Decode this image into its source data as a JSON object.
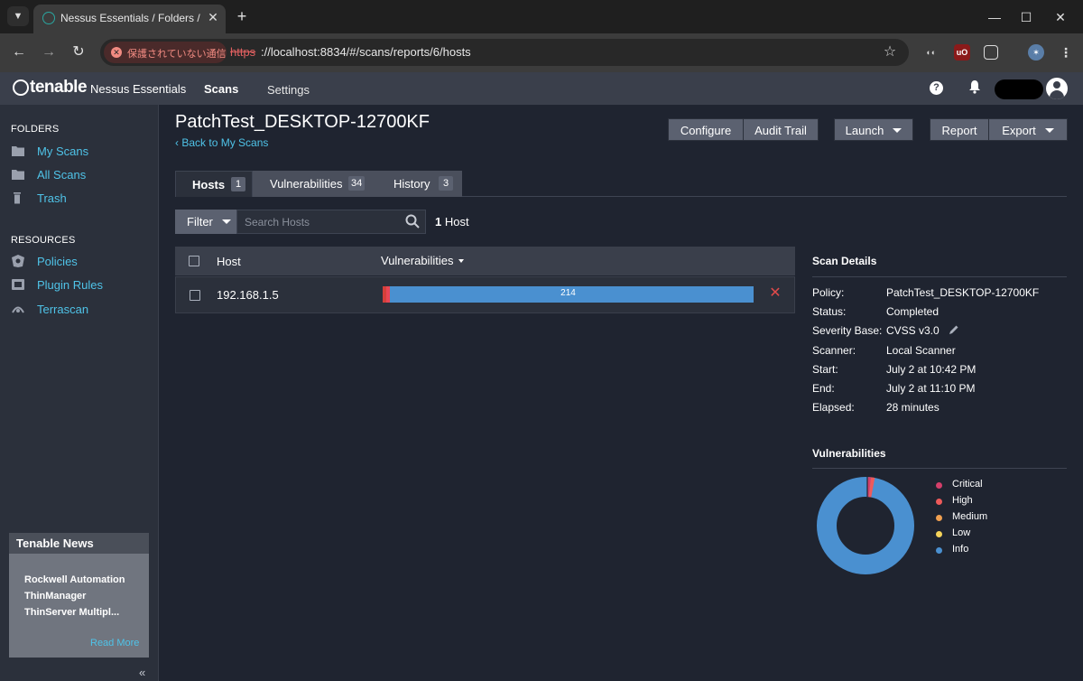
{
  "browser": {
    "tab_title": "Nessus Essentials / Folders / View Scan",
    "security_label": "保護されていない通信",
    "url_scheme": "https",
    "url_rest": "://localhost:8834/#/scans/reports/6/hosts"
  },
  "app": {
    "logo_word": "tenable",
    "logo_product": "Nessus Essentials",
    "nav_scans": "Scans",
    "nav_settings": "Settings"
  },
  "sidebar": {
    "folders_heading": "FOLDERS",
    "folders": [
      {
        "label": "My Scans",
        "icon": "folder-icon"
      },
      {
        "label": "All Scans",
        "icon": "folder-icon"
      },
      {
        "label": "Trash",
        "icon": "trash-icon"
      }
    ],
    "resources_heading": "RESOURCES",
    "resources": [
      {
        "label": "Policies",
        "icon": "policy-shield-icon"
      },
      {
        "label": "Plugin Rules",
        "icon": "plugin-rules-icon"
      },
      {
        "label": "Terrascan",
        "icon": "terrascan-icon"
      }
    ],
    "news": {
      "title": "Tenable News",
      "line1": "Rockwell Automation",
      "line2": "ThinManager",
      "line3": "ThinServer Multipl...",
      "read_more": "Read More"
    }
  },
  "main": {
    "title": "PatchTest_DESKTOP-12700KF",
    "back_link": "Back to My Scans",
    "buttons": {
      "configure": "Configure",
      "audit_trail": "Audit Trail",
      "launch": "Launch",
      "report": "Report",
      "export": "Export"
    },
    "tabs": [
      {
        "label": "Hosts",
        "count": "1"
      },
      {
        "label": "Vulnerabilities",
        "count": "34"
      },
      {
        "label": "History",
        "count": "3"
      }
    ],
    "filter_label": "Filter",
    "search_placeholder": "Search Hosts",
    "host_count_num": "1",
    "host_count_word": "Host",
    "table": {
      "col_host": "Host",
      "col_vulns": "Vulnerabilities",
      "rows": [
        {
          "host": "192.168.1.5",
          "total": "214"
        }
      ]
    }
  },
  "details": {
    "heading": "Scan Details",
    "policy_key": "Policy:",
    "policy_val": "PatchTest_DESKTOP-12700KF",
    "status_key": "Status:",
    "status_val": "Completed",
    "severity_key": "Severity Base:",
    "severity_val": "CVSS v3.0",
    "scanner_key": "Scanner:",
    "scanner_val": "Local Scanner",
    "start_key": "Start:",
    "start_val": "July 2 at 10:42 PM",
    "end_key": "End:",
    "end_val": "July 2 at 11:10 PM",
    "elapsed_key": "Elapsed:",
    "elapsed_val": "28 minutes"
  },
  "vulnerabilities": {
    "heading": "Vulnerabilities",
    "legend": [
      {
        "label": "Critical",
        "color": "#d43f6a"
      },
      {
        "label": "High",
        "color": "#ee5a5a"
      },
      {
        "label": "Medium",
        "color": "#f0a050"
      },
      {
        "label": "Low",
        "color": "#f5d35a"
      },
      {
        "label": "Info",
        "color": "#4a90d0"
      }
    ]
  },
  "colors": {
    "accent_link": "#4fc3e8",
    "info_blue": "#4a90d0",
    "critical_red": "#d43f3a"
  }
}
